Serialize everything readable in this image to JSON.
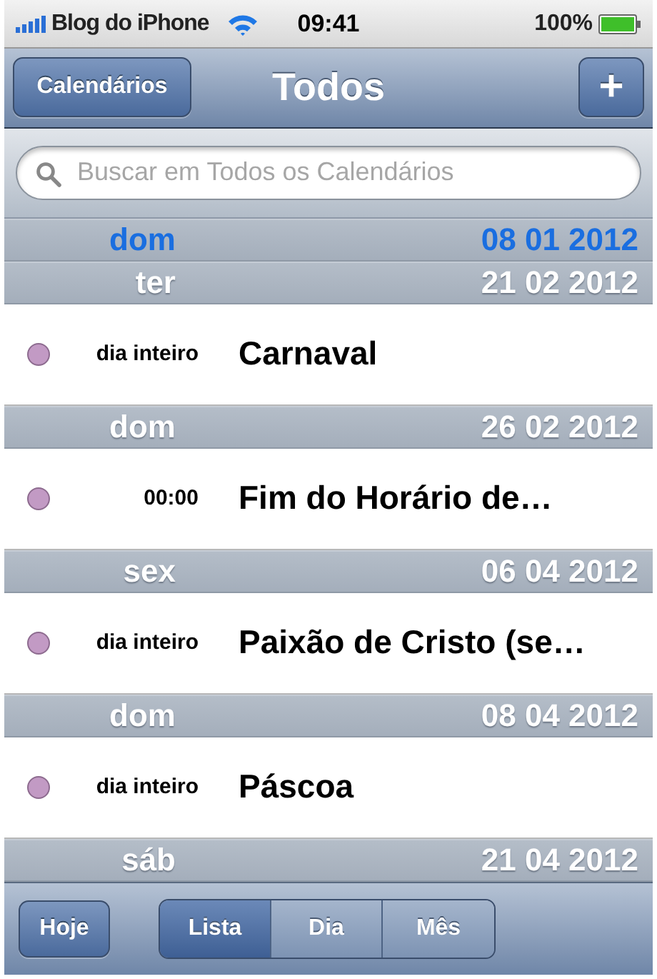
{
  "status_bar": {
    "carrier": "Blog do iPhone",
    "time": "09:41",
    "battery": "100%"
  },
  "nav": {
    "left_button": "Calendários",
    "title": "Todos",
    "right_button": "+"
  },
  "search": {
    "placeholder": "Buscar em Todos os Calendários"
  },
  "sections": [
    {
      "weekday": "dom",
      "date": "08 01 2012",
      "today": true
    },
    {
      "weekday": "ter",
      "date": "21 02 2012",
      "today": false,
      "events": [
        {
          "time": "dia inteiro",
          "title": "Carnaval",
          "color": "#c29ac4"
        }
      ]
    },
    {
      "weekday": "dom",
      "date": "26 02 2012",
      "today": false,
      "events": [
        {
          "time": "00:00",
          "title": "Fim do Horário de…",
          "color": "#c29ac4"
        }
      ]
    },
    {
      "weekday": "sex",
      "date": "06 04 2012",
      "today": false,
      "events": [
        {
          "time": "dia inteiro",
          "title": "Paixão de Cristo (se…",
          "color": "#c29ac4"
        }
      ]
    },
    {
      "weekday": "dom",
      "date": "08 04 2012",
      "today": false,
      "events": [
        {
          "time": "dia inteiro",
          "title": "Páscoa",
          "color": "#c29ac4"
        }
      ]
    },
    {
      "weekday": "sáb",
      "date": "21 04 2012",
      "today": false
    }
  ],
  "toolbar": {
    "today_button": "Hoje",
    "segments": [
      {
        "label": "Lista",
        "selected": true
      },
      {
        "label": "Dia",
        "selected": false
      },
      {
        "label": "Mês",
        "selected": false
      }
    ]
  }
}
